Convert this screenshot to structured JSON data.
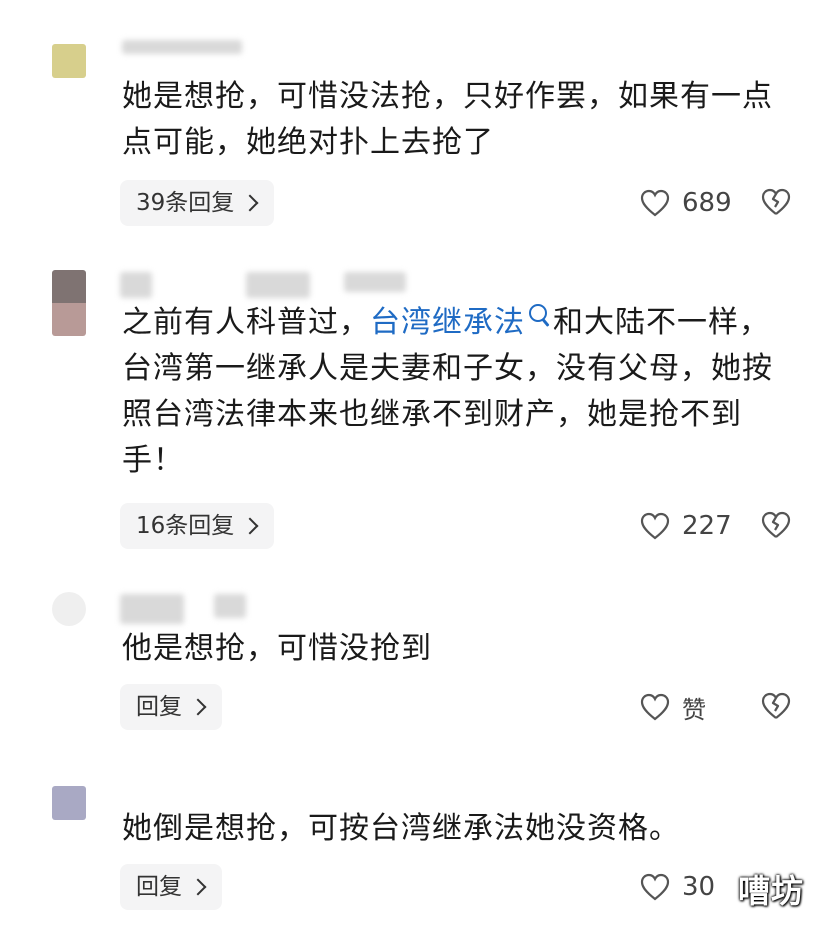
{
  "comments": [
    {
      "text": "她是想抢，可惜没法抢，只好作罢，如果有一点点可能，她绝对扑上去抢了",
      "reply_label": "39条回复",
      "likes": "689",
      "avatar_color": "#d7cf8c"
    },
    {
      "text_before": "之前有人科普过，",
      "link_text": "台湾继承法",
      "text_after": "和大陆不一样，台湾第一继承人是夫妻和子女，没有父母，她按照台湾法律本来也继承不到财产，她是抢不到手！",
      "reply_label": "16条回复",
      "likes": "227",
      "avatar_color": "#8a7a78"
    },
    {
      "text": "他是想抢，可惜没抢到",
      "reply_label": "回复",
      "likes": "赞",
      "avatar_color": "#e6e6e6"
    },
    {
      "text": "她倒是想抢，可按台湾继承法她没资格。",
      "reply_label": "回复",
      "likes": "30",
      "avatar_color": "#a9a9c4"
    }
  ],
  "icons": {
    "like": "heart-icon",
    "dislike": "broken-heart-icon",
    "search": "search-icon",
    "chevron": "chevron-right-icon"
  },
  "watermark": "嘈坊"
}
